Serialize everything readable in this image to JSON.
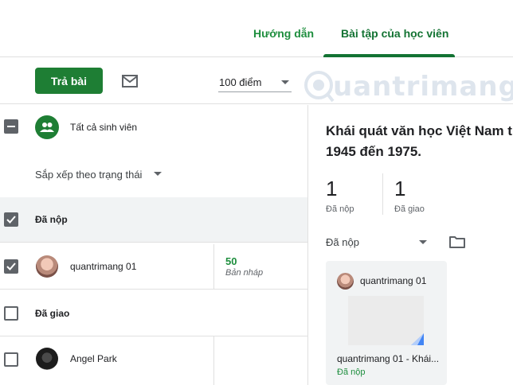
{
  "tabs": {
    "guide": "Hướng dẫn",
    "student_work": "Bài tập của học viên"
  },
  "toolbar": {
    "return_label": "Trả bài",
    "points_value": "100 điểm"
  },
  "watermark": {
    "text": "uantrimang"
  },
  "students_panel": {
    "all_students": "Tất cả sinh viên",
    "sort_label": "Sắp xếp theo trạng thái",
    "submitted_section": "Đã nộp",
    "assigned_section": "Đã giao",
    "students": [
      {
        "name": "quantrimang 01",
        "grade": "50",
        "note": "Bản nháp",
        "checked": true
      },
      {
        "name": "Angel Park",
        "grade": "",
        "note": "",
        "checked": false
      }
    ]
  },
  "assignment": {
    "title_line1": "Khái quát văn học Việt Nam t",
    "title_line2": "1945 đến 1975.",
    "submitted_count": "1",
    "submitted_label": "Đã nộp",
    "assigned_count": "1",
    "assigned_label": "Đã giao",
    "filter_label": "Đã nộp",
    "card": {
      "student": "quantrimang 01",
      "file": "quantrimang 01 - Khái...",
      "status": "Đã nộp"
    }
  },
  "colors": {
    "primary_green": "#1e7e34",
    "tab_green": "#137333",
    "status_green": "#1e8e3e"
  },
  "icons": [
    "mail-icon",
    "group-icon",
    "caret-down-icon",
    "folder-icon",
    "checkbox-icon"
  ]
}
